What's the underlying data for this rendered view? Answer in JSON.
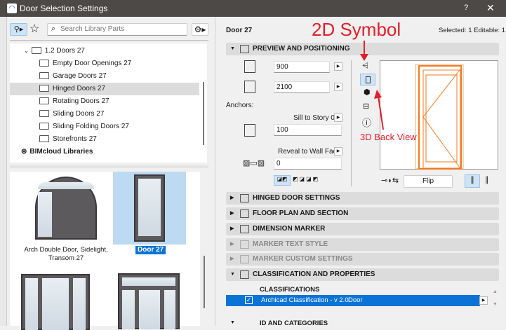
{
  "window": {
    "title": "Door Selection Settings",
    "help": "?",
    "close": "✕"
  },
  "search": {
    "placeholder": "Search Library Parts"
  },
  "tree": {
    "items": [
      {
        "label": "1.2 Doors 27",
        "level": 1,
        "expanded": true
      },
      {
        "label": "Empty Door Openings 27",
        "level": 2
      },
      {
        "label": "Garage Doors 27",
        "level": 2
      },
      {
        "label": "Hinged Doors 27",
        "level": 2,
        "selected": true
      },
      {
        "label": "Rotating Doors 27",
        "level": 2
      },
      {
        "label": "Sliding Doors 27",
        "level": 2
      },
      {
        "label": "Sliding Folding Doors 27",
        "level": 2
      },
      {
        "label": "Storefronts 27",
        "level": 2
      }
    ],
    "bimcloud": "BIMcloud Libraries"
  },
  "thumbs": [
    {
      "label": "Arch Double Door, Sidelight, Transom 27"
    },
    {
      "label": "Door 27",
      "selected": true
    }
  ],
  "header": {
    "name": "Door 27",
    "selection": "Selected: 1 Editable: 1"
  },
  "preview": {
    "title": "PREVIEW AND POSITIONING",
    "width": "900",
    "height": "2100",
    "anchors_label": "Anchors:",
    "sill_label": "Sill to Story 0",
    "sill_value": "100",
    "reveal_label": "Reveal to Wall Face",
    "reveal_value": "0",
    "flip_label": "Flip"
  },
  "sections": [
    {
      "label": "HINGED DOOR SETTINGS",
      "enabled": true
    },
    {
      "label": "FLOOR PLAN AND SECTION",
      "enabled": true
    },
    {
      "label": "DIMENSION MARKER",
      "enabled": true
    },
    {
      "label": "MARKER TEXT STYLE",
      "enabled": false
    },
    {
      "label": "MARKER CUSTOM SETTINGS",
      "enabled": false
    },
    {
      "label": "CLASSIFICATION AND PROPERTIES",
      "enabled": true,
      "expanded": true
    }
  ],
  "classifications": {
    "heading": "CLASSIFICATIONS",
    "row": {
      "system": "Archicad Classification - v 2.0",
      "value": "Door",
      "checked": true
    }
  },
  "id_section": "ID AND CATEGORIES",
  "annotations": {
    "symbol2d": "2D Symbol",
    "back3d": "3D Back View"
  },
  "colors": {
    "accent": "#0a74d6",
    "annotation": "#e0202a",
    "door_line": "#f07a20"
  }
}
